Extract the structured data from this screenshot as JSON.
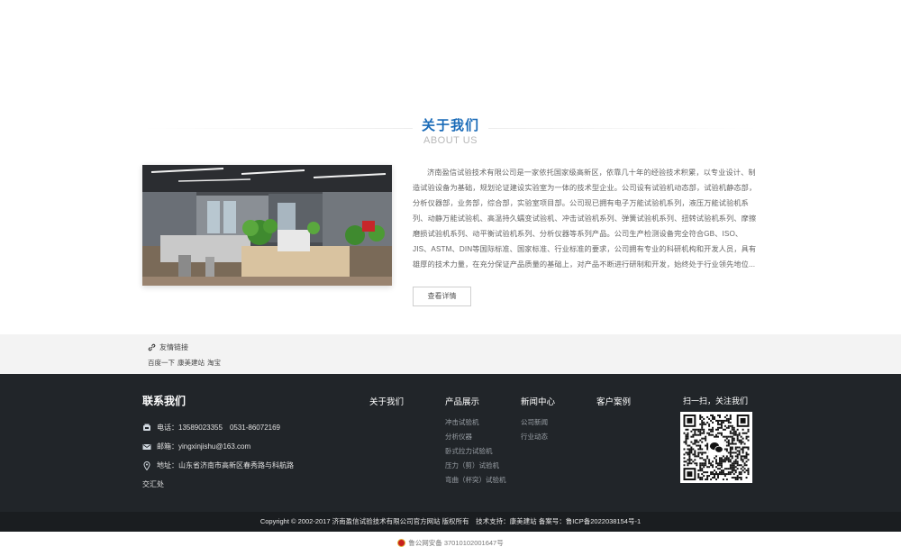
{
  "about": {
    "title": "关于我们",
    "subtitle": "ABOUT US",
    "text": "济南盈信试验技术有限公司是一家依托国家级高新区，依靠几十年的经验技术积累，以专业设计、制造试验设备为基础，规划论证建设实验室为一体的技术型企业。公司设有试验机动态部，试验机静态部，分析仪器部，业务部，综合部，实验室项目部。公司现已拥有电子万能试验机系列，液压万能试验机系列、动静万能试验机、高温持久蠕变试验机、冲击试验机系列、弹簧试验机系列、扭转试验机系列、摩擦磨损试验机系列、动平衡试验机系列、分析仪器等系列产品。公司生产检测设备完全符合GB、ISO、JIS、ASTM、DIN等国际标准、国家标准、行业标准的要求，公司拥有专业的科研机构和开发人员，具有雄厚的技术力量，在充分保证产品质量的基础上，对产品不断进行研制和开发，始终处于行业领先地位...",
    "more_label": "查看详情"
  },
  "links": {
    "title": "友情链接",
    "items": [
      "百度一下",
      "康美建站",
      "淘宝"
    ]
  },
  "footer": {
    "contact_title": "联系我们",
    "phone": "电话：13589023355　0531-86072169",
    "email": "邮箱：yingxinjishu@163.com",
    "address": "地址：山东省济南市高新区春秀路与科航路",
    "address_extra": "交汇处",
    "nav": [
      {
        "title": "关于我们",
        "items": []
      },
      {
        "title": "产品展示",
        "items": [
          "冲击试验机",
          "分析仪器",
          "卧式拉力试验机",
          "压力（剪）试验机",
          "弯曲（杯突）试验机"
        ]
      },
      {
        "title": "新闻中心",
        "items": [
          "公司新闻",
          "行业动态"
        ]
      },
      {
        "title": "客户案例",
        "items": []
      }
    ],
    "qr_title": "扫一扫，关注我们",
    "copyright": "Copyright © 2002-2017 济南盈信试验技术有限公司官方网站 版权所有　技术支持：康美建站 备案号：鲁ICP备2022038154号-1",
    "beian": "鲁公网安备 37010102001647号"
  },
  "icons": {
    "link": "link-icon",
    "phone": "phone-icon",
    "email": "mail-icon",
    "address": "location-pin-icon",
    "qr": "wechat-qr-code",
    "beian": "police-emblem-icon"
  },
  "colors": {
    "accent": "#1a6bb8",
    "footer_bg": "#212529",
    "copyright_bg": "#1a1d20",
    "links_bg": "#f3f3f3"
  }
}
